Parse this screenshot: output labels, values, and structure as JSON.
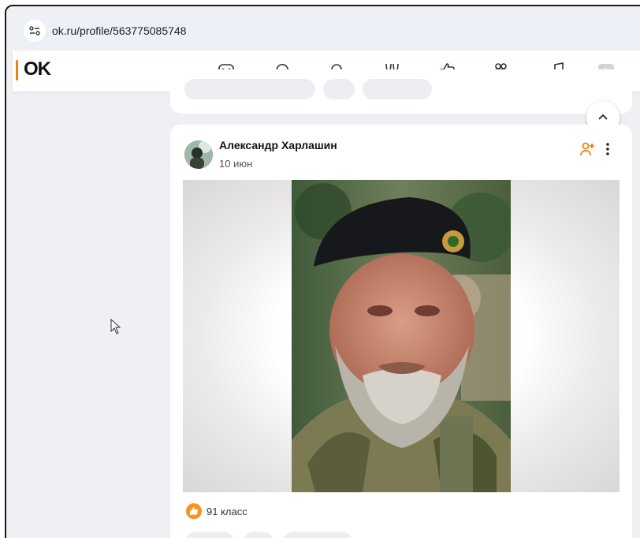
{
  "browser": {
    "url": "ok.ru/profile/563775085748"
  },
  "header": {
    "logo": "OK",
    "nav_icons": [
      "messages-icon",
      "discussions-icon",
      "notifications-icon",
      "guests-icon",
      "events-icon",
      "video-icon",
      "music-icon",
      "games-icon"
    ]
  },
  "post": {
    "author": "Александр Харлашин",
    "date": "10 июн",
    "likes": "91 класс"
  },
  "colors": {
    "accent": "#ee8208",
    "like": "#f7931e"
  }
}
